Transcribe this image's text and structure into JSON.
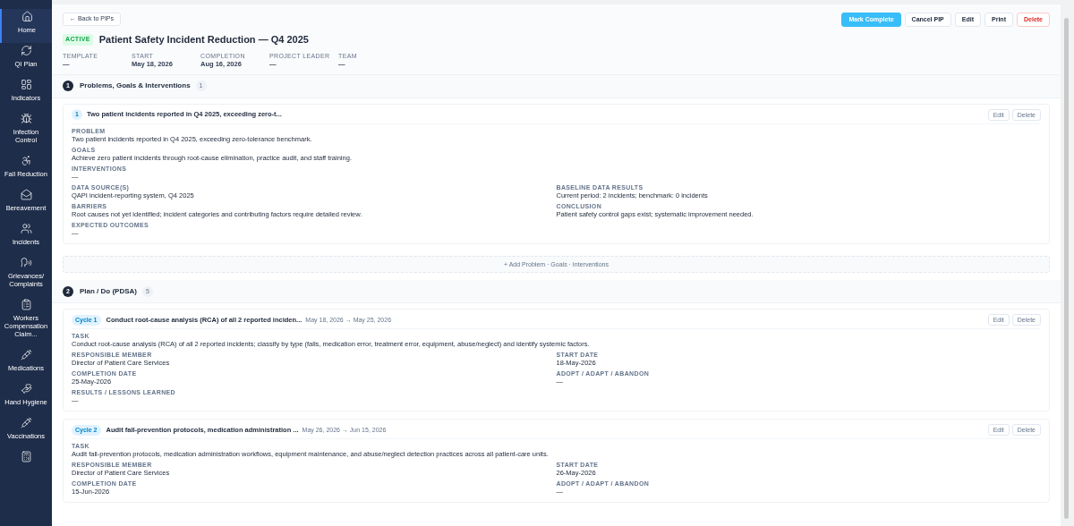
{
  "sidebar": {
    "items": [
      {
        "label": "Home",
        "selected": true
      },
      {
        "label": "QI Plan",
        "selected": false
      },
      {
        "label": "Indicators",
        "selected": false
      },
      {
        "label": "Infection Control",
        "selected": false
      },
      {
        "label": "Fall Reduction",
        "selected": false
      },
      {
        "label": "Bereavement",
        "selected": false
      },
      {
        "label": "Incidents",
        "selected": false
      },
      {
        "label": "Grievances/ Complaints",
        "selected": false
      },
      {
        "label": "Workers Compensation Claim...",
        "selected": false
      },
      {
        "label": "Medications",
        "selected": false
      },
      {
        "label": "Hand Hygiene",
        "selected": false
      },
      {
        "label": "Vaccinations",
        "selected": false
      },
      {
        "selected": false
      }
    ]
  },
  "header": {
    "back": "← Back to PIPs",
    "status": "ACTIVE",
    "title": "Patient Safety Incident Reduction — Q4 2025",
    "actions": [
      {
        "label": "Mark Complete",
        "kind": "primary"
      },
      {
        "label": "Cancel PIP",
        "kind": "default"
      },
      {
        "label": "Edit",
        "kind": "default"
      },
      {
        "label": "Print",
        "kind": "default"
      },
      {
        "label": "Delete",
        "kind": "danger"
      }
    ],
    "meta": [
      {
        "label": "TEMPLATE",
        "value": "—"
      },
      {
        "label": "START",
        "value": "May 18, 2026"
      },
      {
        "label": "COMPLETION",
        "value": "Aug 16, 2026"
      },
      {
        "label": "PROJECT LEADER",
        "value": "—"
      },
      {
        "label": "TEAM",
        "value": "—"
      }
    ]
  },
  "sections": [
    {
      "number": "1",
      "title": "Problems, Goals & Interventions",
      "count": "1",
      "kind": "problems",
      "cards": [
        {
          "badge": "1",
          "title": "Two patient incidents reported in Q4 2025, exceeding zero-t...",
          "actions": [
            "Edit",
            "Delete"
          ],
          "top_fields": [
            {
              "label": "PROBLEM",
              "value": "Two patient incidents reported in Q4 2025, exceeding zero-tolerance benchmark."
            },
            {
              "label": "GOALS",
              "value": "Achieve zero patient incidents through root-cause elimination, practice audit, and staff training."
            },
            {
              "label": "INTERVENTIONS",
              "value": "—"
            }
          ],
          "left_fields": [
            {
              "label": "DATA SOURCE(S)",
              "value": "QAPI incident-reporting system, Q4 2025"
            },
            {
              "label": "BARRIERS",
              "value": "Root causes not yet identified; incident categories and contributing factors require detailed review."
            },
            {
              "label": "EXPECTED OUTCOMES",
              "value": "—"
            }
          ],
          "right_fields": [
            {
              "label": "BASELINE DATA RESULTS",
              "value": "Current period: 2 incidents; benchmark: 0 incidents"
            },
            {
              "label": "CONCLUSION",
              "value": "Patient safety control gaps exist; systematic improvement needed."
            }
          ]
        }
      ],
      "add_button": "+ Add Problem · Goals · Interventions"
    },
    {
      "number": "2",
      "title": "Plan / Do (PDSA)",
      "count": "5",
      "kind": "cycles",
      "cards": [
        {
          "badge": "Cycle 1",
          "title": "Conduct root-cause analysis (RCA) of all 2 reported inciden...",
          "dates": "May 18, 2026 → May 25, 2026",
          "actions": [
            "Edit",
            "Delete"
          ],
          "top_fields": [
            {
              "label": "TASK",
              "value": "Conduct root-cause analysis (RCA) of all 2 reported incidents; classify by type (falls, medication error, treatment error, equipment, abuse/neglect) and identify systemic factors."
            }
          ],
          "left_fields": [
            {
              "label": "RESPONSIBLE MEMBER",
              "value": "Director of Patient Care Services"
            },
            {
              "label": "COMPLETION DATE",
              "value": "25-May-2026"
            },
            {
              "label": "RESULTS / LESSONS LEARNED",
              "value": "—"
            }
          ],
          "right_fields": [
            {
              "label": "START DATE",
              "value": "18-May-2026"
            },
            {
              "label": "ADOPT / ADAPT / ABANDON",
              "value": "—"
            }
          ]
        },
        {
          "badge": "Cycle 2",
          "title": "Audit fall-prevention protocols, medication administration ...",
          "dates": "May 26, 2026 → Jun 15, 2026",
          "actions": [
            "Edit",
            "Delete"
          ],
          "top_fields": [
            {
              "label": "TASK",
              "value": "Audit fall-prevention protocols, medication administration workflows, equipment maintenance, and abuse/neglect detection practices across all patient-care units."
            }
          ],
          "left_fields": [
            {
              "label": "RESPONSIBLE MEMBER",
              "value": "Director of Patient Care Services"
            },
            {
              "label": "COMPLETION DATE",
              "value": "15-Jun-2026"
            }
          ],
          "right_fields": [
            {
              "label": "START DATE",
              "value": "26-May-2026"
            },
            {
              "label": "ADOPT / ADAPT / ABANDON",
              "value": "—"
            }
          ]
        }
      ]
    }
  ]
}
